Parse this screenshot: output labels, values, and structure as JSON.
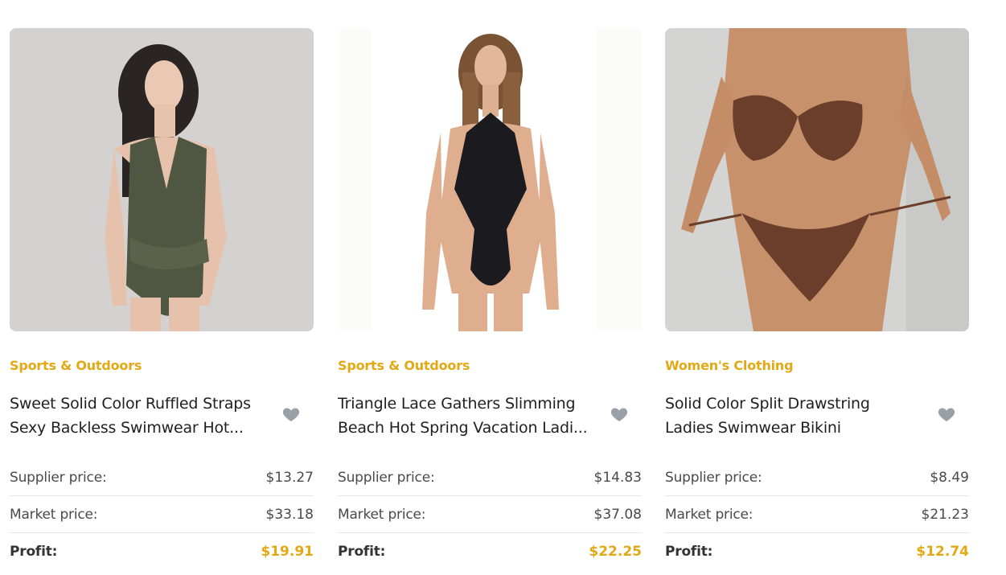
{
  "colors": {
    "accent": "#e3a915",
    "heart": "#9aa0a8"
  },
  "products": [
    {
      "category": "Sports & Outdoors",
      "title_line1": "Sweet Solid Color Ruffled Straps",
      "title_line2": "Sexy Backless Swimwear Hot...",
      "favorite_icon": "heart-icon",
      "supplier_label": "Supplier price:",
      "supplier_price": "$13.27",
      "market_label": "Market price:",
      "market_price": "$33.18",
      "profit_label": "Profit:",
      "profit": "$19.91"
    },
    {
      "category": "Sports & Outdoors",
      "title_line1": "Triangle Lace Gathers Slimming",
      "title_line2": "Beach Hot Spring Vacation Ladi...",
      "favorite_icon": "heart-icon",
      "supplier_label": "Supplier price:",
      "supplier_price": "$14.83",
      "market_label": "Market price:",
      "market_price": "$37.08",
      "profit_label": "Profit:",
      "profit": "$22.25"
    },
    {
      "category": "Women's Clothing",
      "title_line1": "Solid Color Split Drawstring",
      "title_line2": "Ladies Swimwear Bikini",
      "favorite_icon": "heart-icon",
      "supplier_label": "Supplier price:",
      "supplier_price": "$8.49",
      "market_label": "Market price:",
      "market_price": "$21.23",
      "profit_label": "Profit:",
      "profit": "$12.74"
    }
  ]
}
